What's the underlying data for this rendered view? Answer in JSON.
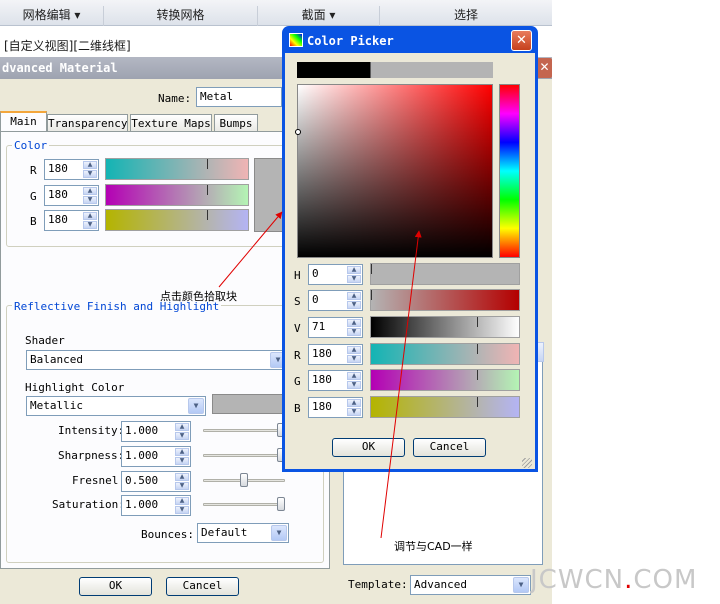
{
  "ribbon": {
    "items": [
      "网格编辑",
      "转换网格",
      "截面",
      "选择"
    ],
    "view_label": "[自定义视图][二维线框]"
  },
  "material_dialog": {
    "title": "dvanced Material",
    "name_label": "Name:",
    "name_value": "Metal",
    "tabs": [
      "Main",
      "Transparency",
      "Texture Maps",
      "Bumps"
    ],
    "color_group": "Color",
    "rgb": [
      {
        "label": "R",
        "value": "180"
      },
      {
        "label": "G",
        "value": "180"
      },
      {
        "label": "B",
        "value": "180"
      }
    ],
    "reflective_group": "Reflective Finish and Highlight",
    "shader_label": "Shader",
    "shader_value": "Balanced",
    "highlight_label": "Highlight Color",
    "highlight_value": "Metallic",
    "params": [
      {
        "label": "Intensity:",
        "value": "1.000",
        "level": 1.0
      },
      {
        "label": "Sharpness:",
        "value": "1.000",
        "level": 1.0
      },
      {
        "label": "Fresnel:",
        "value": "0.500",
        "level": 0.5
      },
      {
        "label": "Saturation:",
        "value": "1.000",
        "level": 1.0
      }
    ],
    "bounces_label": "Bounces:",
    "bounces_value": "Default",
    "ok_label": "OK",
    "cancel_label": "Cancel",
    "template_label": "Template:",
    "template_value": "Advanced"
  },
  "color_picker": {
    "title": "Color Picker",
    "close_glyph": "✕",
    "hsv": [
      {
        "label": "H",
        "value": "0"
      },
      {
        "label": "S",
        "value": "0"
      },
      {
        "label": "V",
        "value": "71"
      }
    ],
    "rgb": [
      {
        "label": "R",
        "value": "180"
      },
      {
        "label": "G",
        "value": "180"
      },
      {
        "label": "B",
        "value": "180"
      }
    ],
    "ok_label": "OK",
    "cancel_label": "Cancel",
    "current_color": "#b4b4b4"
  },
  "annotations": {
    "click_swatch": "点击颜色拾取块",
    "same_as_cad": "调节与CAD一样"
  },
  "watermark": "JCWCN.COM 中国教程网"
}
